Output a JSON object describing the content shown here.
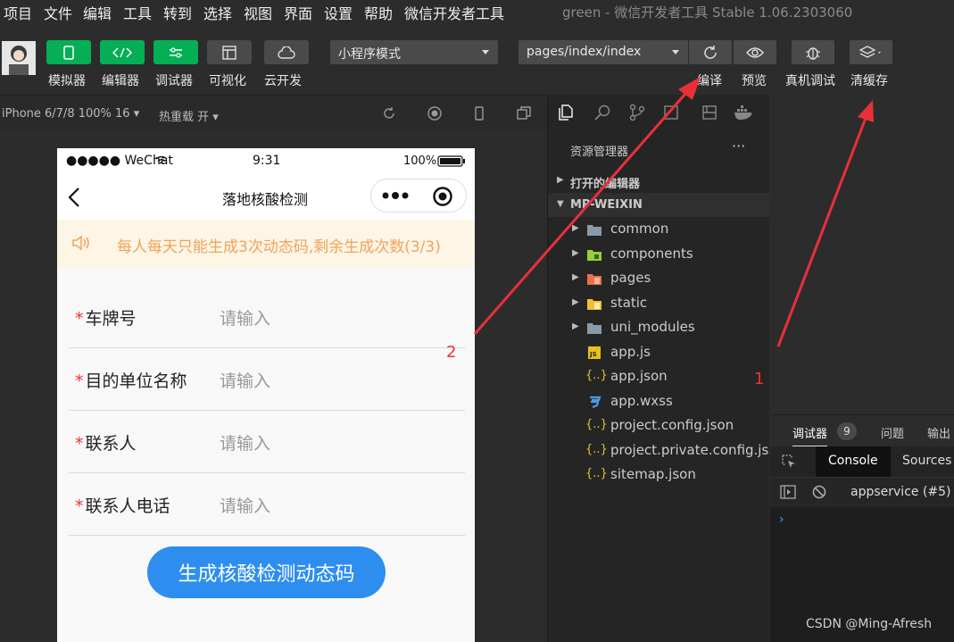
{
  "menu": [
    "项目",
    "文件",
    "编辑",
    "工具",
    "转到",
    "选择",
    "视图",
    "界面",
    "设置",
    "帮助",
    "微信开发者工具"
  ],
  "window_title": "green - 微信开发者工具 Stable 1.06.2303060",
  "toolbar": {
    "left_buttons": [
      "模拟器",
      "编辑器",
      "调试器",
      "可视化",
      "云开发"
    ],
    "mode_select": "小程序模式",
    "page_select": "pages/index/index",
    "right_buttons": [
      "编译",
      "预览",
      "真机调试",
      "清缓存"
    ]
  },
  "simbar": {
    "device": "iPhone 6/7/8 100% 16 ▾",
    "hot_reload": "热重载 开 ▾"
  },
  "phone": {
    "signal": "●●●●● WeChat",
    "time": "9:31",
    "battery": "100%",
    "nav_title": "落地核酸检测",
    "notice": "每人每天只能生成3次动态码,剩余生成次数(3/3)",
    "form": [
      {
        "label": "车牌号",
        "placeholder": "请输入"
      },
      {
        "label": "目的单位名称",
        "placeholder": "请输入"
      },
      {
        "label": "联系人",
        "placeholder": "请输入"
      },
      {
        "label": "联系人电话",
        "placeholder": "请输入"
      }
    ],
    "required_mark": "*",
    "submit": "生成核酸检测动态码"
  },
  "explorer": {
    "title": "资源管理器",
    "more": "···",
    "open_editors": "打开的编辑器",
    "project": "MP-WEIXIN",
    "items": [
      {
        "name": "common",
        "type": "folder",
        "color": "#8a9aa8"
      },
      {
        "name": "components",
        "type": "folder",
        "color": "#9ccc3c"
      },
      {
        "name": "pages",
        "type": "folder",
        "color": "#e8704a"
      },
      {
        "name": "static",
        "type": "folder",
        "color": "#f0c030"
      },
      {
        "name": "uni_modules",
        "type": "folder",
        "color": "#8a9aa8"
      },
      {
        "name": "app.js",
        "type": "js"
      },
      {
        "name": "app.json",
        "type": "json"
      },
      {
        "name": "app.wxss",
        "type": "css"
      },
      {
        "name": "project.config.json",
        "type": "json"
      },
      {
        "name": "project.private.config.js...",
        "type": "json"
      },
      {
        "name": "sitemap.json",
        "type": "json"
      }
    ]
  },
  "debugger": {
    "tabs": [
      "调试器",
      "问题",
      "输出"
    ],
    "badge": "9",
    "console_tabs": [
      "Console",
      "Sources"
    ],
    "context": "appservice (#5)",
    "prompt": "›"
  },
  "annotations": [
    "1",
    "2"
  ],
  "watermark": "CSDN @Ming-Afresh",
  "colors": {
    "accent_green": "#06ae56",
    "button_blue": "#2e8ef0",
    "notice_text": "#f0a45a",
    "arrow_red": "#e8303a"
  }
}
